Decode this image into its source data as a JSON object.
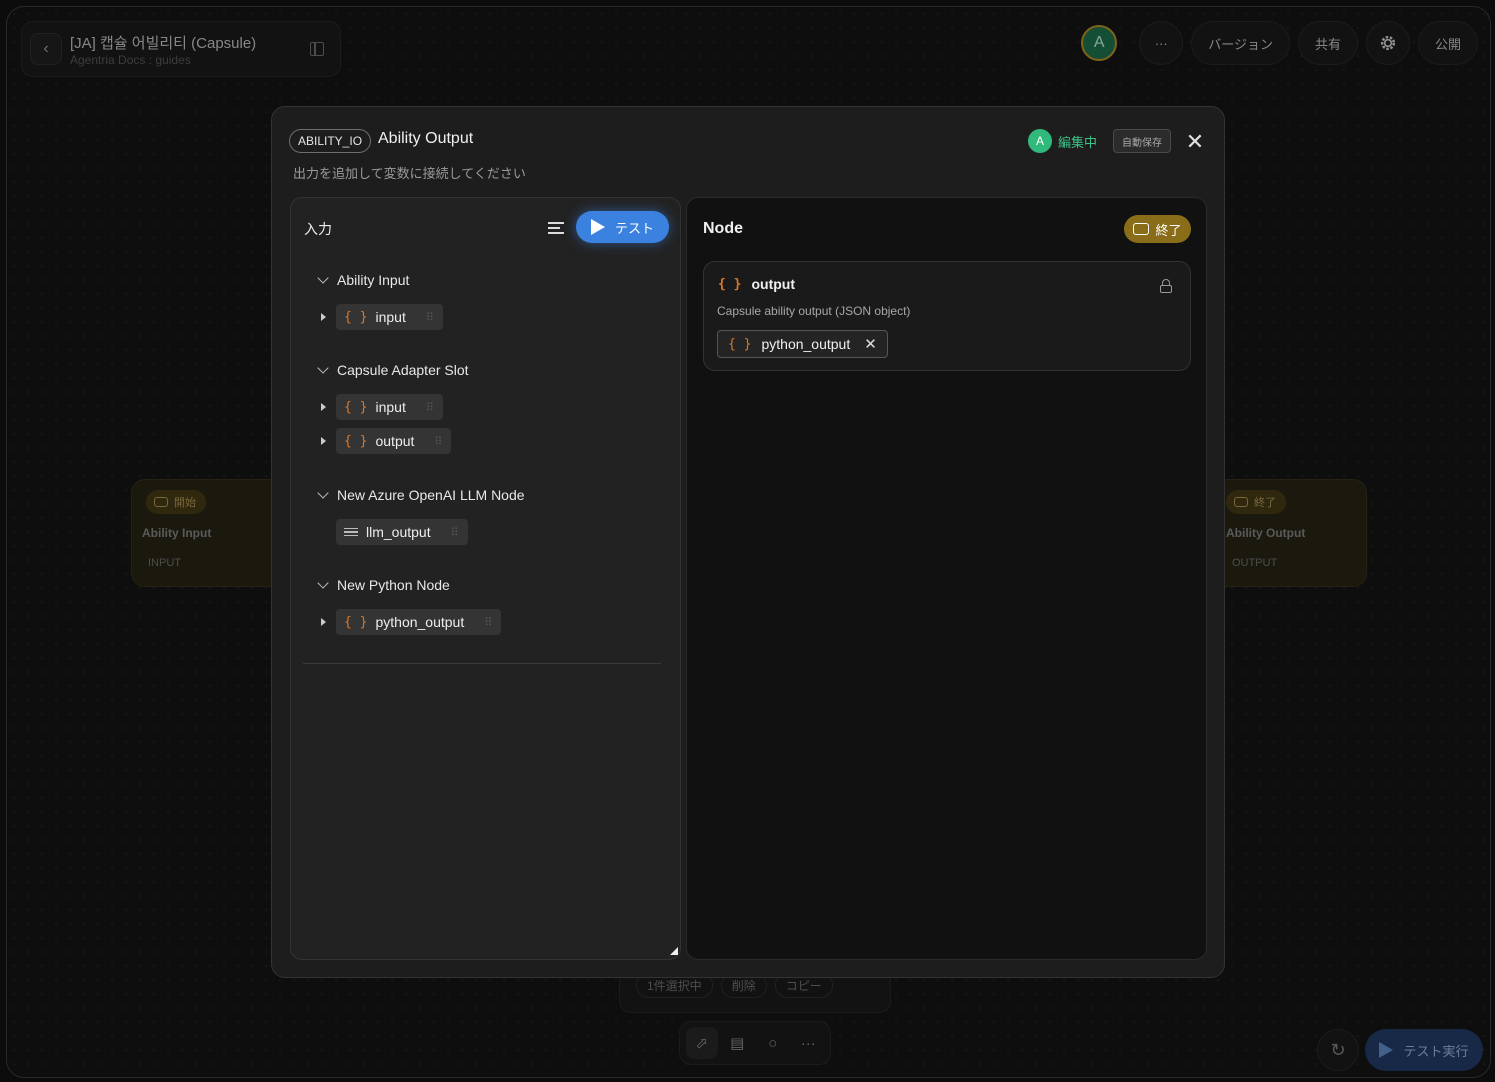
{
  "header": {
    "title": "[JA] 캡슐 어빌리티 (Capsule)",
    "subtitle": "Agentria Docs : guides"
  },
  "toolbar": {
    "avatar": "A",
    "more": "···",
    "version": "バージョン",
    "share": "共有",
    "publish": "公開"
  },
  "background_nodes": {
    "start": {
      "tag": "開始",
      "name": "Ability Input",
      "io": "INPUT"
    },
    "end": {
      "tag": "終了",
      "name": "Ability Output",
      "io": "OUTPUT"
    }
  },
  "selection_bar": {
    "count": "1件選択中",
    "delete": "削除",
    "copy": "コピー"
  },
  "test_run": "テスト実行",
  "modal": {
    "type_badge": "ABILITY_IO",
    "title": "Ability Output",
    "description": "出力を追加して変数に接続してください",
    "editing_avatar": "A",
    "editing_label": "編集中",
    "autosave": "自動保存",
    "close": "✕",
    "input_panel": {
      "title": "入力",
      "test_button": "テスト",
      "groups": [
        {
          "name": "Ability Input",
          "vars": [
            {
              "label": "input",
              "type": "object",
              "expandable": true
            }
          ]
        },
        {
          "name": "Capsule Adapter Slot",
          "vars": [
            {
              "label": "input",
              "type": "object",
              "expandable": true
            },
            {
              "label": "output",
              "type": "object",
              "expandable": true
            }
          ]
        },
        {
          "name": "New Azure OpenAI LLM Node",
          "vars": [
            {
              "label": "llm_output",
              "type": "text",
              "expandable": false
            }
          ]
        },
        {
          "name": "New Python Node",
          "vars": [
            {
              "label": "python_output",
              "type": "object",
              "expandable": true
            }
          ]
        }
      ]
    },
    "node_panel": {
      "title": "Node",
      "end_badge": "終了",
      "output": {
        "name": "output",
        "description": "Capsule ability output (JSON object)",
        "connected": "python_output"
      }
    }
  },
  "icons": {
    "brace": "{ }",
    "grip": "⠿",
    "history": "↻"
  },
  "colors": {
    "accent_blue": "#3b82e0",
    "brace_orange": "#d97a2b",
    "end_gold": "#8a6d18",
    "editing_green": "#2fb97b"
  }
}
